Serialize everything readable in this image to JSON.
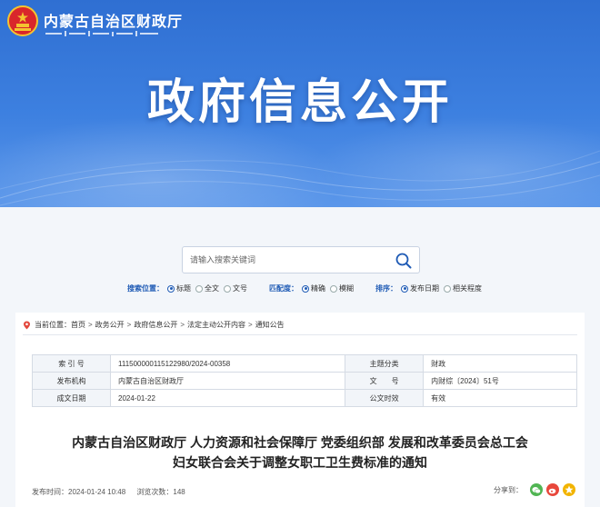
{
  "header": {
    "site_name": "内蒙古自治区财政厅",
    "banner_title": "政府信息公开",
    "colors": {
      "banner_top": "#2f6fd2",
      "banner_bottom": "#5b97ea",
      "accent": "#1f5bb5"
    }
  },
  "search": {
    "placeholder": "请输入搜索关键词",
    "icon": "search-icon"
  },
  "filters": {
    "position": {
      "label": "搜索位置：",
      "options": [
        {
          "label": "标题",
          "selected": true
        },
        {
          "label": "全文",
          "selected": false
        },
        {
          "label": "文号",
          "selected": false
        }
      ]
    },
    "match": {
      "label": "匹配度：",
      "options": [
        {
          "label": "精确",
          "selected": true
        },
        {
          "label": "模糊",
          "selected": false
        }
      ]
    },
    "sort": {
      "label": "排序：",
      "options": [
        {
          "label": "发布日期",
          "selected": true
        },
        {
          "label": "相关程度",
          "selected": false
        }
      ]
    }
  },
  "breadcrumb": {
    "prefix": "当前位置：",
    "items": [
      "首页",
      "政务公开",
      "政府信息公开",
      "法定主动公开内容",
      "通知公告"
    ],
    "separator": ">"
  },
  "meta": {
    "rows": [
      {
        "k1": "索 引 号",
        "v1": "11150000011512298​0/2024-00358",
        "k2": "主题分类",
        "v2": "财政"
      },
      {
        "k1": "发布机构",
        "v1": "内蒙古自治区财政厅",
        "k2": "文　　号",
        "v2": "内财综〔2024〕51号"
      },
      {
        "k1": "成文日期",
        "v1": "2024-01-22",
        "k2": "公文时效",
        "v2": "有效"
      }
    ]
  },
  "document": {
    "title_line1": "内蒙古自治区财政厅 人力资源和社会保障厅  党委组织部 发展和改革委员会总工会",
    "title_line2": "妇女联合会关于调整女职工卫生费标准的通知"
  },
  "pubinfo": {
    "published": "发布时间：2024-01-24 10:48",
    "views": "浏览次数：148"
  },
  "share": {
    "label": "分享到：",
    "icons": [
      "wechat-icon",
      "weibo-icon",
      "qzone-icon"
    ]
  }
}
